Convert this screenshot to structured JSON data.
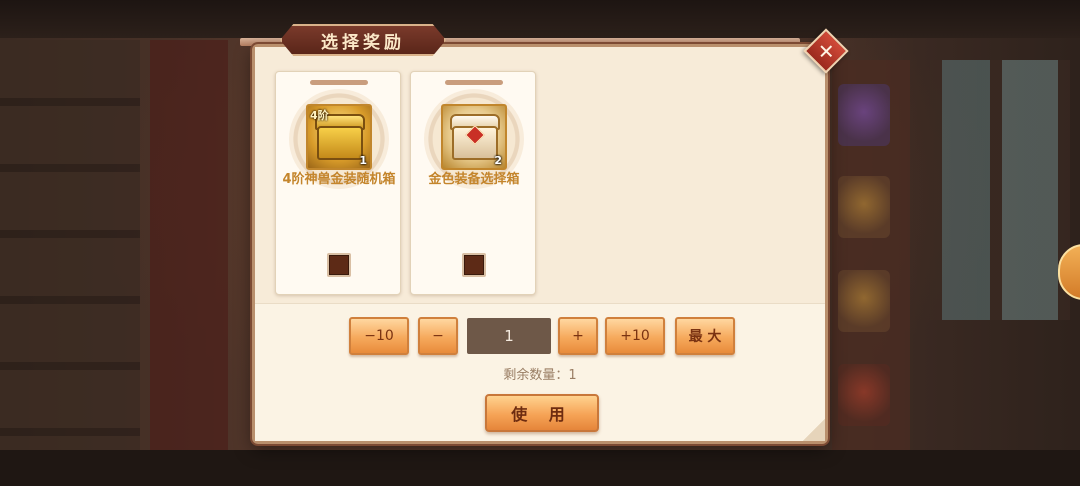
{
  "dialog": {
    "title": "选择奖励",
    "close_icon": "close-x-icon"
  },
  "rewards": [
    {
      "tier_badge": "4阶",
      "quantity": "1",
      "name": "4阶神兽金装随机箱",
      "icon": "golden-chest-icon",
      "selected": false
    },
    {
      "quantity": "2",
      "name": "金色装备选择箱",
      "icon": "white-gold-chest-icon",
      "selected": false
    }
  ],
  "quantity_controls": {
    "minus10": "−10",
    "minus1": "−",
    "value": "1",
    "plus1": "+",
    "plus10": "+10",
    "max": "最 大"
  },
  "remaining_label": "剩余数量：1",
  "use_button": "使 用"
}
